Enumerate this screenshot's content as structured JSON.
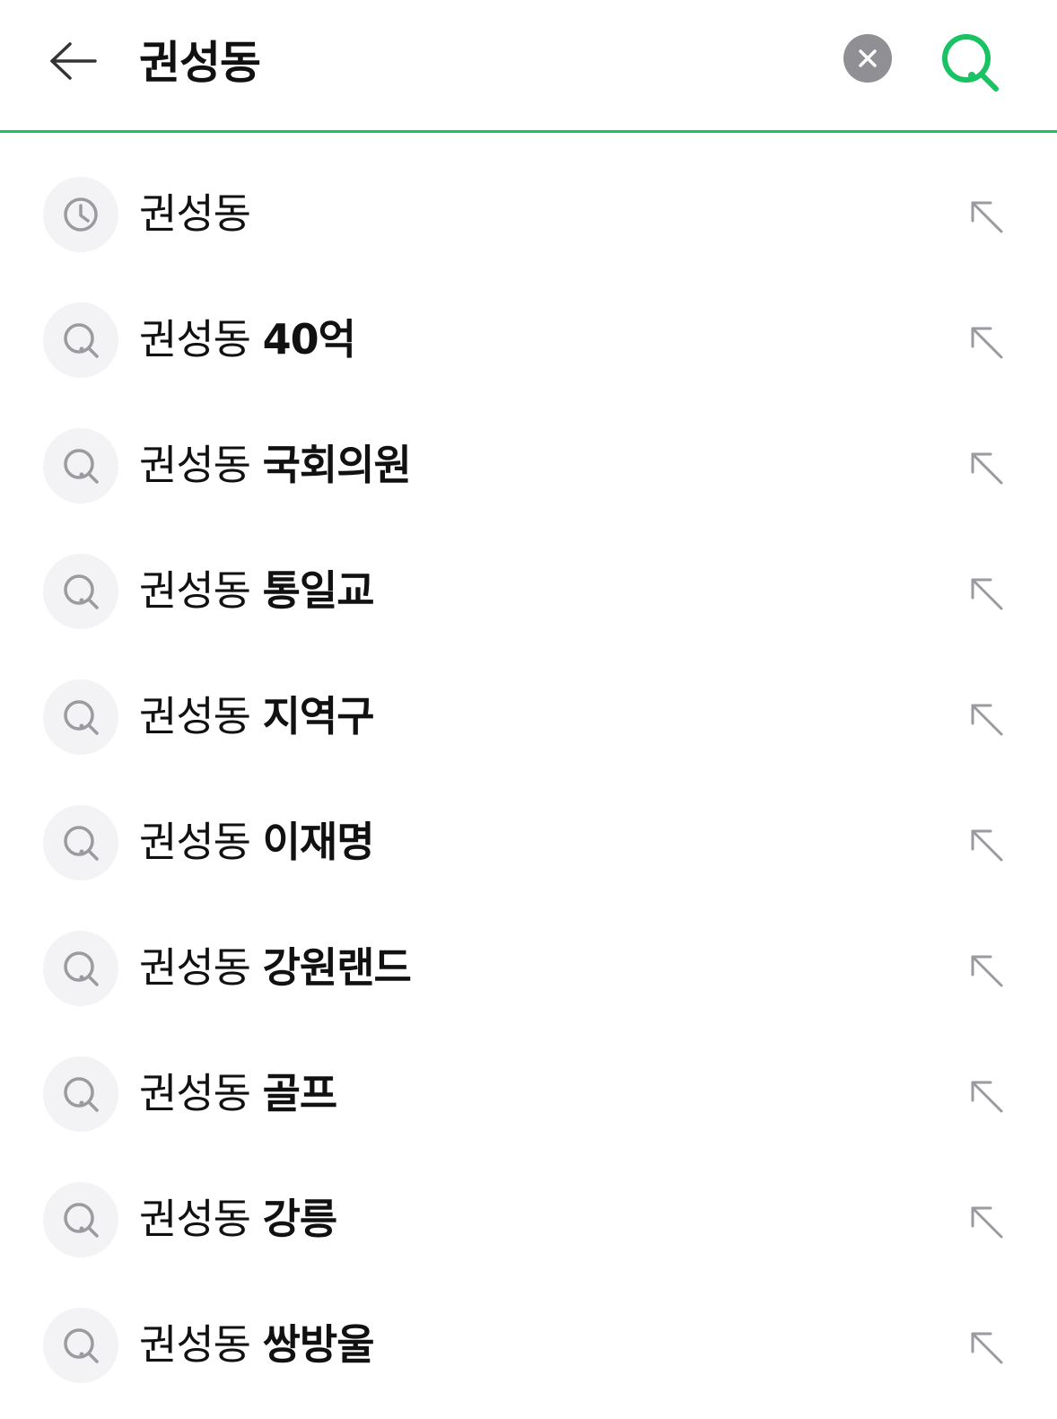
{
  "header": {
    "back_icon": "arrow-left-icon",
    "query": "권성동",
    "clear_icon": "close-icon",
    "search_icon": "search-icon",
    "accent_color": "#19c262"
  },
  "suggestions": [
    {
      "type": "history",
      "icon": "clock-icon",
      "base": "권성동",
      "extra": ""
    },
    {
      "type": "suggestion",
      "icon": "search-icon",
      "base": "권성동",
      "extra": "40억"
    },
    {
      "type": "suggestion",
      "icon": "search-icon",
      "base": "권성동",
      "extra": "국회의원"
    },
    {
      "type": "suggestion",
      "icon": "search-icon",
      "base": "권성동",
      "extra": "통일교"
    },
    {
      "type": "suggestion",
      "icon": "search-icon",
      "base": "권성동",
      "extra": "지역구"
    },
    {
      "type": "suggestion",
      "icon": "search-icon",
      "base": "권성동",
      "extra": "이재명"
    },
    {
      "type": "suggestion",
      "icon": "search-icon",
      "base": "권성동",
      "extra": "강원랜드"
    },
    {
      "type": "suggestion",
      "icon": "search-icon",
      "base": "권성동",
      "extra": "골프"
    },
    {
      "type": "suggestion",
      "icon": "search-icon",
      "base": "권성동",
      "extra": "강릉"
    },
    {
      "type": "suggestion",
      "icon": "search-icon",
      "base": "권성동",
      "extra": "쌍방울"
    }
  ]
}
